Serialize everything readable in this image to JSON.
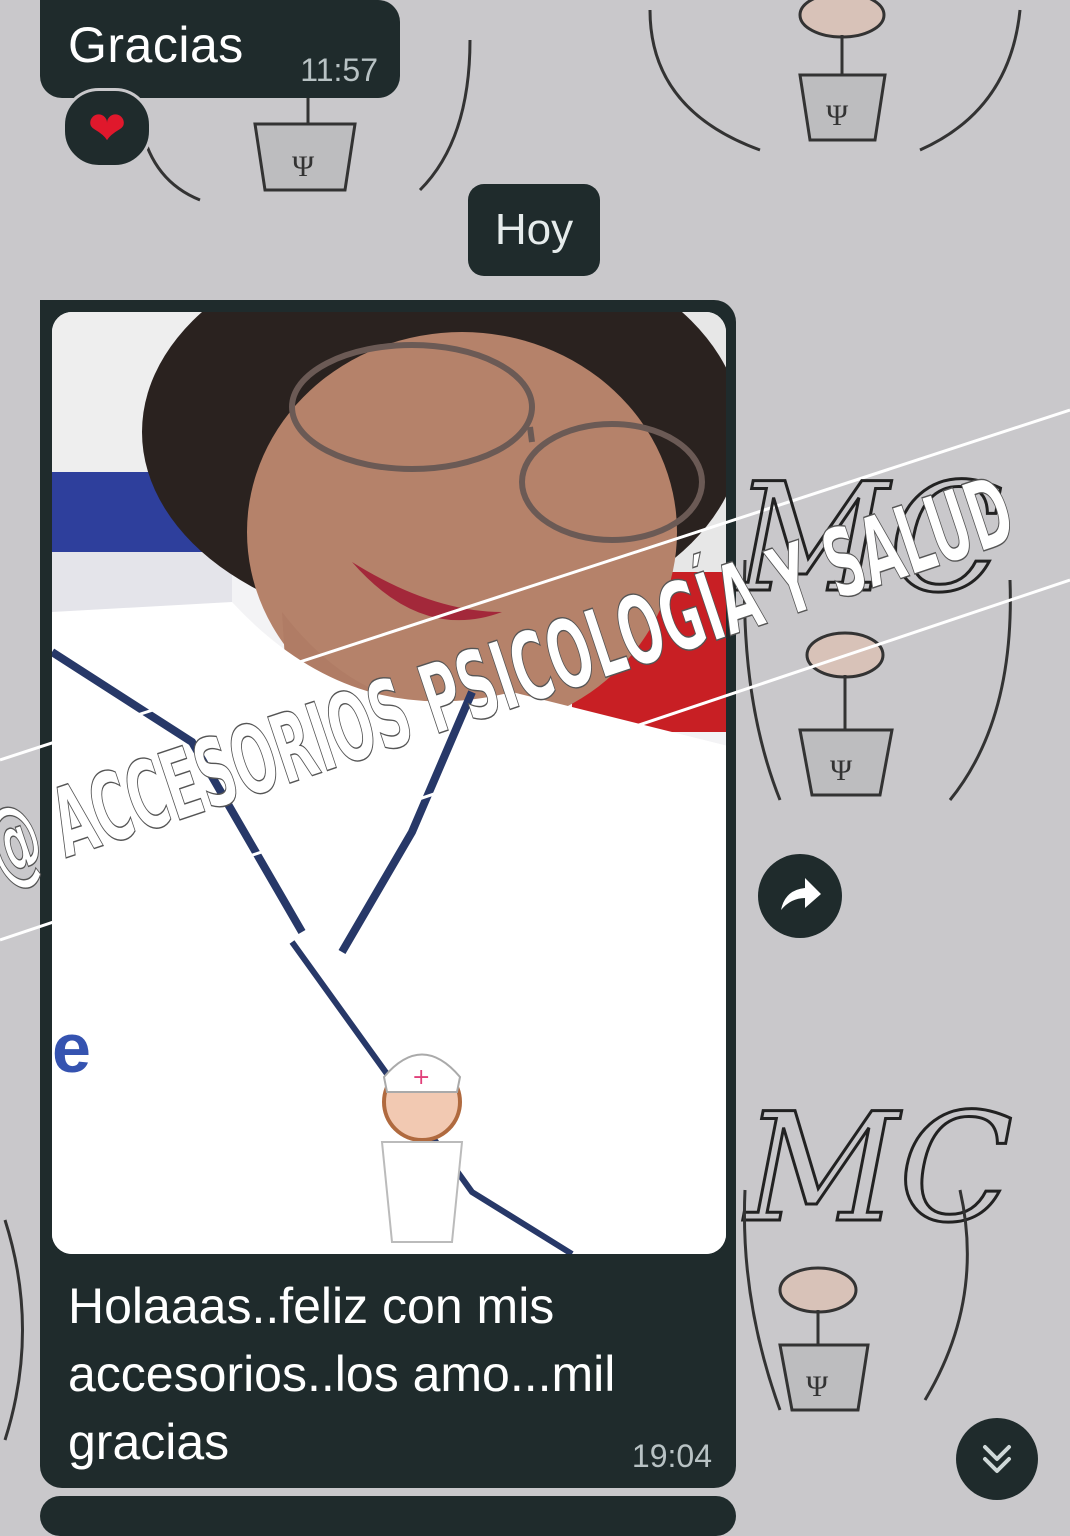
{
  "chat": {
    "previous_message": {
      "text": "Gracias",
      "time": "11:57",
      "reaction": "❤"
    },
    "date_separator": "Hoy",
    "photo_message": {
      "caption": "Holaaas..feliz con mis accesorios..los amo...mil gracias",
      "time": "19:04"
    }
  },
  "wallpaper": {
    "logo_text": "MC",
    "icon": "brain-flower-pot-icon"
  },
  "watermark": {
    "text": "@ ACCESORIOS PSICOLOGÍA Y SALUD",
    "logo_text": "MC"
  },
  "icons": {
    "forward": "forward-arrow-icon",
    "scroll_down": "double-chevron-down-icon"
  },
  "colors": {
    "background": "#c9c8cb",
    "bubble": "#1f2b2c",
    "heart": "#e0182c"
  }
}
